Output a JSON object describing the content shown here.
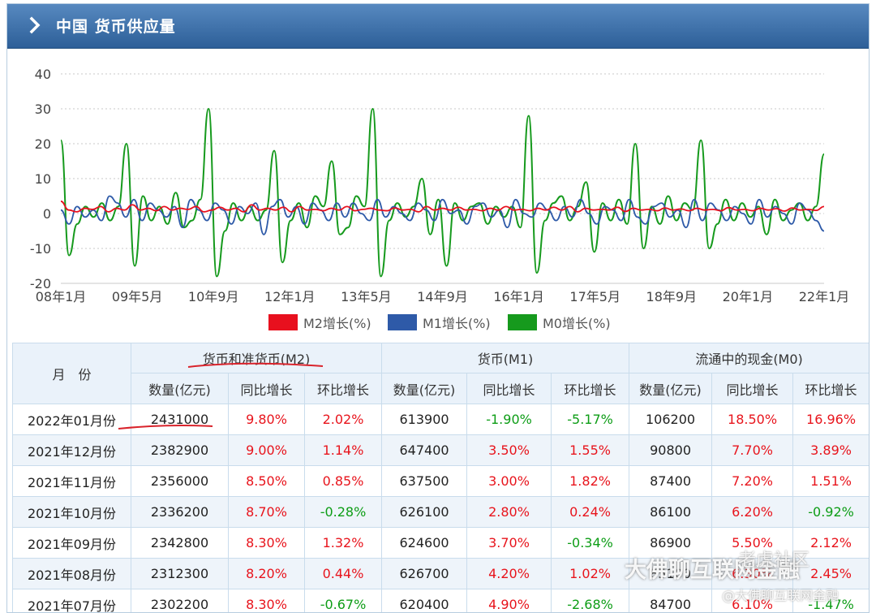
{
  "header": {
    "title": "中国 货币供应量"
  },
  "chart_data": {
    "type": "line",
    "ylim": [
      -20,
      40
    ],
    "yticks": [
      40,
      30,
      20,
      10,
      0,
      -10,
      -20
    ],
    "xticks": [
      "08年1月",
      "09年5月",
      "10年9月",
      "12年1月",
      "13年5月",
      "14年9月",
      "16年1月",
      "17年5月",
      "18年9月",
      "20年1月",
      "22年1月"
    ],
    "grid": true,
    "legend_position": "bottom",
    "series": [
      {
        "name": "M2增长(%)",
        "color": "#e8101e",
        "values": [
          3.5,
          1,
          0.5,
          1.5,
          1.2,
          2,
          0.5,
          1.5,
          1,
          2.5,
          1,
          1.5,
          0.8,
          2,
          1,
          1.5,
          1.2,
          2,
          0.5,
          1,
          1.8,
          1,
          1.5,
          0.5,
          2.5,
          1,
          1.5,
          1,
          1.8,
          0.5,
          2,
          1,
          1.2,
          0.8,
          1.5,
          1,
          2,
          0.8,
          1.2,
          1.5,
          1,
          0.8,
          1.6,
          1,
          1.2,
          0.5,
          2,
          1,
          1.5,
          1,
          1.8,
          1,
          1.2,
          0.8,
          1.5,
          1,
          2,
          1,
          1.2,
          0.8,
          1.5,
          1,
          1.8,
          1,
          2,
          0.5,
          1.5,
          1,
          1.2,
          1,
          1.8,
          0.6,
          1.5,
          1,
          1.2,
          0.8,
          1.6,
          1,
          1.3,
          0.8,
          1.5,
          1,
          1.2,
          0.8,
          1.7,
          1,
          1.2,
          0.8,
          1.5,
          1,
          1.4,
          0.7,
          1.6,
          1,
          1.2,
          0.9,
          2
        ]
      },
      {
        "name": "M1增长(%)",
        "color": "#2e5aa8",
        "values": [
          1,
          -3,
          2,
          -1,
          1,
          -2,
          5,
          3,
          -1,
          4,
          -2,
          3,
          1,
          -1,
          2,
          -4,
          4,
          1,
          -2,
          3,
          1,
          -3,
          2,
          0,
          3,
          -6,
          2,
          4,
          -1,
          2,
          -3,
          3,
          1,
          -2,
          3,
          -1,
          3,
          0,
          -2,
          4,
          -1,
          2,
          0,
          -2,
          3,
          1,
          -2,
          4,
          0,
          1,
          -3,
          2,
          3,
          -1,
          1,
          -4,
          4,
          0,
          -1,
          3,
          1,
          -2,
          2,
          -1,
          4,
          0,
          -3,
          2,
          1,
          -2,
          4,
          -1,
          -3,
          2,
          3,
          -1,
          1,
          -4,
          4,
          -2,
          3,
          1,
          -2,
          2,
          0,
          -3,
          4,
          -1,
          2,
          0,
          -3,
          3,
          1,
          -2,
          -5
        ]
      },
      {
        "name": "M0增长(%)",
        "color": "#169a1d",
        "values": [
          21,
          -12,
          -3,
          2,
          -1,
          3,
          -2,
          2,
          20,
          -15,
          5,
          -2,
          2,
          -3,
          6,
          -4,
          -2,
          4,
          30,
          -18,
          -5,
          3,
          -2,
          2,
          -2,
          1,
          18,
          -14,
          -2,
          3,
          -4,
          5,
          2,
          15,
          -6,
          -4,
          5,
          2,
          30,
          -18,
          -2,
          3,
          -1,
          2,
          10,
          -6,
          4,
          -15,
          3,
          -2,
          2,
          3,
          -3,
          2,
          -1,
          2,
          -4,
          28,
          -17,
          -2,
          3,
          5,
          -2,
          2,
          9,
          -11,
          3,
          -2,
          4,
          -3,
          20,
          -10,
          2,
          -3,
          5,
          -2,
          3,
          1,
          21,
          -10,
          -3,
          4,
          -2,
          3,
          -1,
          2,
          -6,
          4,
          -2,
          1,
          3,
          -2,
          2,
          17
        ]
      }
    ]
  },
  "table": {
    "month_header": "月　份",
    "groups": [
      "货币和准货币(M2)",
      "货币(M1)",
      "流通中的现金(M0)"
    ],
    "subheaders": [
      "数量(亿元)",
      "同比增长",
      "环比增长",
      "数量(亿元)",
      "同比增长",
      "环比增长",
      "数量(亿元)",
      "同比增长",
      "环比增长"
    ],
    "rows": [
      [
        "2022年01月份",
        "2431000",
        "9.80%",
        "2.02%",
        "613900",
        "-1.90%",
        "-5.17%",
        "106200",
        "18.50%",
        "16.96%"
      ],
      [
        "2021年12月份",
        "2382900",
        "9.00%",
        "1.14%",
        "647400",
        "3.50%",
        "1.55%",
        "90800",
        "7.70%",
        "3.89%"
      ],
      [
        "2021年11月份",
        "2356000",
        "8.50%",
        "0.85%",
        "637500",
        "3.00%",
        "1.82%",
        "87400",
        "7.20%",
        "1.51%"
      ],
      [
        "2021年10月份",
        "2336200",
        "8.70%",
        "-0.28%",
        "626100",
        "2.80%",
        "0.24%",
        "86100",
        "6.20%",
        "-0.92%"
      ],
      [
        "2021年09月份",
        "2342800",
        "8.30%",
        "1.32%",
        "624600",
        "3.70%",
        "-0.34%",
        "86900",
        "5.50%",
        "2.12%"
      ],
      [
        "2021年08月份",
        "2312300",
        "8.20%",
        "0.44%",
        "626700",
        "4.20%",
        "1.02%",
        "85100",
        "6.30%",
        "2.45%"
      ],
      [
        "2021年07月份",
        "2302200",
        "8.30%",
        "-0.67%",
        "620400",
        "4.90%",
        "-2.68%",
        "84700",
        "6.10%",
        "-1.47%"
      ]
    ]
  },
  "watermark": {
    "main": "大佛聊互联网金融",
    "top": "老虎社区",
    "bottom": "@大佛聊互联网金融"
  }
}
